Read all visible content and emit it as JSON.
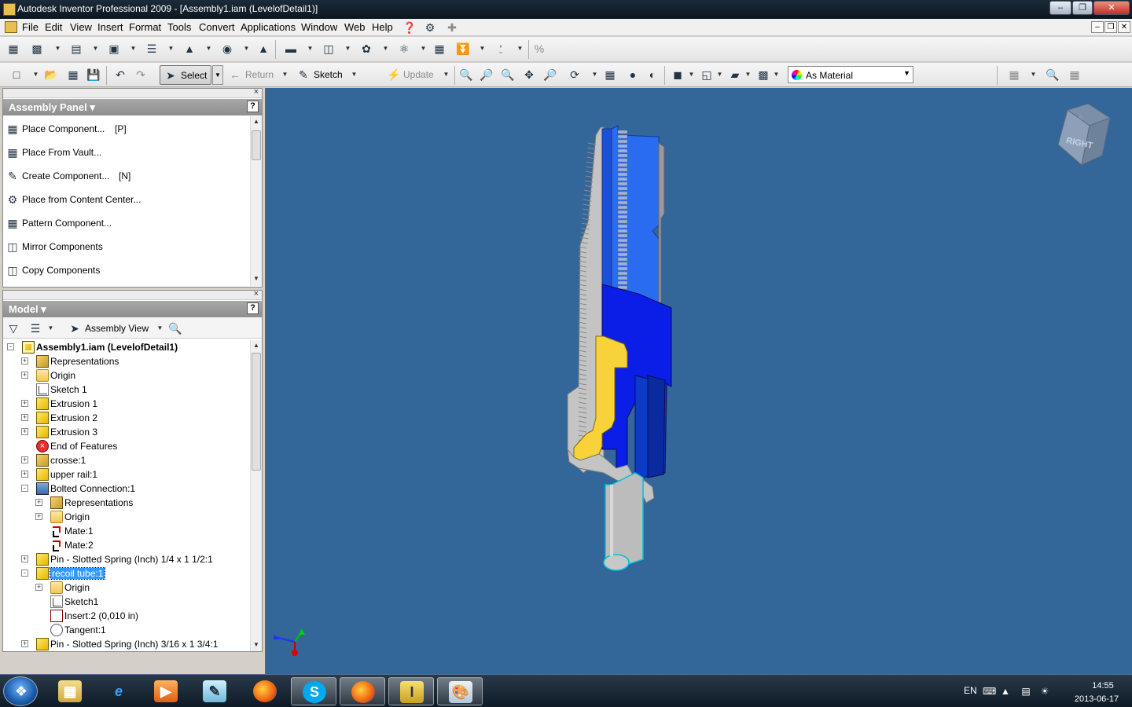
{
  "window": {
    "title": "Autodesk Inventor Professional 2009 - [Assembly1.iam (LevelofDetail1)]"
  },
  "menu": {
    "items": [
      "File",
      "Edit",
      "View",
      "Insert",
      "Format",
      "Tools",
      "Convert",
      "Applications",
      "Window",
      "Web",
      "Help"
    ]
  },
  "toolbar": {
    "select_label": "Select",
    "return_label": "Return",
    "sketch_label": "Sketch",
    "update_label": "Update",
    "material_value": "As Material"
  },
  "assembly_panel": {
    "title": "Assembly Panel",
    "items": [
      {
        "label": "Place Component...",
        "shortcut": "[P]",
        "icon": "place-component-icon"
      },
      {
        "label": "Place From Vault...",
        "shortcut": "",
        "icon": "place-from-vault-icon"
      },
      {
        "label": "Create Component...",
        "shortcut": "[N]",
        "icon": "create-component-icon"
      },
      {
        "label": "Place from Content Center...",
        "shortcut": "",
        "icon": "content-center-icon"
      },
      {
        "label": "Pattern Component...",
        "shortcut": "",
        "icon": "pattern-component-icon"
      },
      {
        "label": "Mirror Components",
        "shortcut": "",
        "icon": "mirror-components-icon"
      },
      {
        "label": "Copy Components",
        "shortcut": "",
        "icon": "copy-components-icon"
      }
    ]
  },
  "model_panel": {
    "title": "Model",
    "view_label": "Assembly View",
    "tree": [
      {
        "label": "Assembly1.iam (LevelofDetail1)",
        "icon": "assembly",
        "level": 0,
        "expander": "-",
        "bold": true
      },
      {
        "label": "Representations",
        "icon": "representations",
        "level": 1,
        "expander": "+"
      },
      {
        "label": "Origin",
        "icon": "folder",
        "level": 1,
        "expander": "+"
      },
      {
        "label": "Sketch 1",
        "icon": "sketch",
        "level": 1,
        "expander": ""
      },
      {
        "label": "Extrusion 1",
        "icon": "part",
        "level": 1,
        "expander": "+"
      },
      {
        "label": "Extrusion 2",
        "icon": "part",
        "level": 1,
        "expander": "+"
      },
      {
        "label": "Extrusion 3",
        "icon": "part",
        "level": 1,
        "expander": "+"
      },
      {
        "label": "End of Features",
        "icon": "end",
        "level": 1,
        "expander": ""
      },
      {
        "label": "crosse:1",
        "icon": "content",
        "level": 1,
        "expander": "+"
      },
      {
        "label": "upper rail:1",
        "icon": "part-sync",
        "level": 1,
        "expander": "+"
      },
      {
        "label": "Bolted Connection:1",
        "icon": "bolted",
        "level": 1,
        "expander": "-"
      },
      {
        "label": "Representations",
        "icon": "representations",
        "level": 2,
        "expander": "+"
      },
      {
        "label": "Origin",
        "icon": "folder",
        "level": 2,
        "expander": "+"
      },
      {
        "label": "Mate:1",
        "icon": "mate",
        "level": 2,
        "expander": ""
      },
      {
        "label": "Mate:2",
        "icon": "mate",
        "level": 2,
        "expander": ""
      },
      {
        "label": "Pin - Slotted Spring (Inch) 1/4 x 1 1/2:1",
        "icon": "part",
        "level": 1,
        "expander": "+"
      },
      {
        "label": "recoil tube:1",
        "icon": "part",
        "level": 1,
        "expander": "-",
        "selected": true
      },
      {
        "label": "Origin",
        "icon": "folder",
        "level": 2,
        "expander": "+"
      },
      {
        "label": "Sketch1",
        "icon": "sketch",
        "level": 2,
        "expander": ""
      },
      {
        "label": "Insert:2 (0,010 in)",
        "icon": "insert",
        "level": 2,
        "expander": ""
      },
      {
        "label": "Tangent:1",
        "icon": "tangent",
        "level": 2,
        "expander": ""
      },
      {
        "label": "Pin - Slotted Spring (Inch) 3/16 x 1 3/4:1",
        "icon": "part",
        "level": 1,
        "expander": "+"
      }
    ]
  },
  "viewcube": {
    "face_label": "RIGHT"
  },
  "colors": {
    "viewport_bg": "#336699",
    "part_blue": "#0a1ee8",
    "part_light_blue": "#2a6cf0",
    "part_yellow": "#f7d23a",
    "part_gray": "#b9b9b9"
  },
  "taskbar": {
    "apps": [
      "windows-explorer",
      "internet-explorer",
      "media-player",
      "notes",
      "firefox",
      "skype",
      "firefox",
      "autodesk-inventor",
      "paint"
    ],
    "language": "EN",
    "time": "14:55",
    "date": "2013-06-17"
  }
}
